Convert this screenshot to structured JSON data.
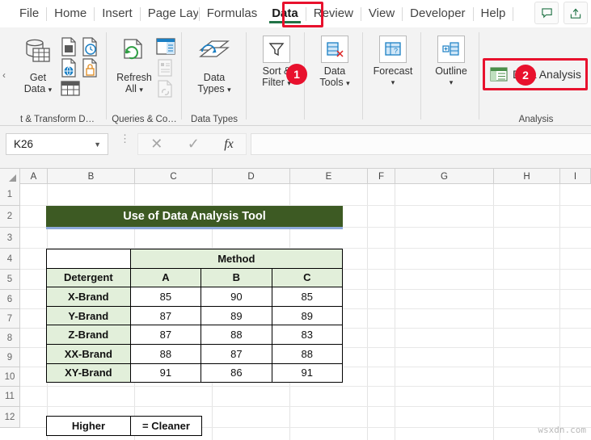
{
  "ribbon_tabs": [
    {
      "label": "File",
      "active": false
    },
    {
      "label": "Home",
      "active": false
    },
    {
      "label": "Insert",
      "active": false
    },
    {
      "label": "Page Layou",
      "active": false
    },
    {
      "label": "Formulas",
      "active": false
    },
    {
      "label": "Data",
      "active": true
    },
    {
      "label": "Review",
      "active": false
    },
    {
      "label": "View",
      "active": false
    },
    {
      "label": "Developer",
      "active": false
    },
    {
      "label": "Help",
      "active": false
    }
  ],
  "titlebar": {
    "comment_icon": "comment-icon",
    "share_icon": "share-icon"
  },
  "ribbon": {
    "collapse_icon": "chevron-left-icon",
    "groups": [
      {
        "label": "t & Transform D…"
      },
      {
        "label": "Queries & Co…"
      },
      {
        "label": "Data Types"
      },
      {
        "label": ""
      },
      {
        "label": ""
      },
      {
        "label": ""
      },
      {
        "label": ""
      },
      {
        "label": "Analysis"
      }
    ],
    "buttons": {
      "get_data": "Get\nData",
      "get_data_label_l1": "Get",
      "get_data_label_l2": "Data",
      "refresh_all_l1": "Refresh",
      "refresh_all_l2": "All",
      "data_types_l1": "Data",
      "data_types_l2": "Types",
      "sort_filter_l1": "Sort &",
      "sort_filter_l2": "Filter",
      "data_tools_l1": "Data",
      "data_tools_l2": "Tools",
      "forecast_l1": "Forecast",
      "outline_l1": "Outline",
      "data_analysis": "Data Analysis"
    },
    "callouts": [
      {
        "number": "1"
      },
      {
        "number": "2"
      }
    ]
  },
  "formula_bar": {
    "name_box_value": "K26",
    "cancel_icon": "cancel-x-icon",
    "enter_icon": "checkmark-icon",
    "function_icon": "fx-icon",
    "formula_value": ""
  },
  "grid": {
    "columns": [
      "A",
      "B",
      "C",
      "D",
      "E",
      "F",
      "G",
      "H",
      "I"
    ],
    "rows": [
      "1",
      "2",
      "3",
      "4",
      "5",
      "6",
      "7",
      "8",
      "9",
      "10",
      "11",
      "12"
    ]
  },
  "sheet": {
    "title_banner": "Use of Data Analysis Tool",
    "table": {
      "group_header": "Method",
      "corner_header": "Detergent",
      "method_columns": [
        "A",
        "B",
        "C"
      ],
      "rows": [
        {
          "detergent": "X-Brand",
          "values": [
            "85",
            "90",
            "85"
          ]
        },
        {
          "detergent": "Y-Brand",
          "values": [
            "87",
            "89",
            "89"
          ]
        },
        {
          "detergent": "Z-Brand",
          "values": [
            "87",
            "88",
            "83"
          ]
        },
        {
          "detergent": "XX-Brand",
          "values": [
            "88",
            "87",
            "88"
          ]
        },
        {
          "detergent": "XY-Brand",
          "values": [
            "91",
            "86",
            "91"
          ]
        }
      ]
    },
    "legend": {
      "left": "Higher",
      "right": "= Cleaner"
    }
  },
  "watermark": "wsxdn.com",
  "colors": {
    "accent_green": "#3d5a23",
    "header_green": "#e2efda",
    "callout_red": "#e8112d",
    "tab_underline": "#217346",
    "title_underline_blue": "#8eaadb"
  }
}
